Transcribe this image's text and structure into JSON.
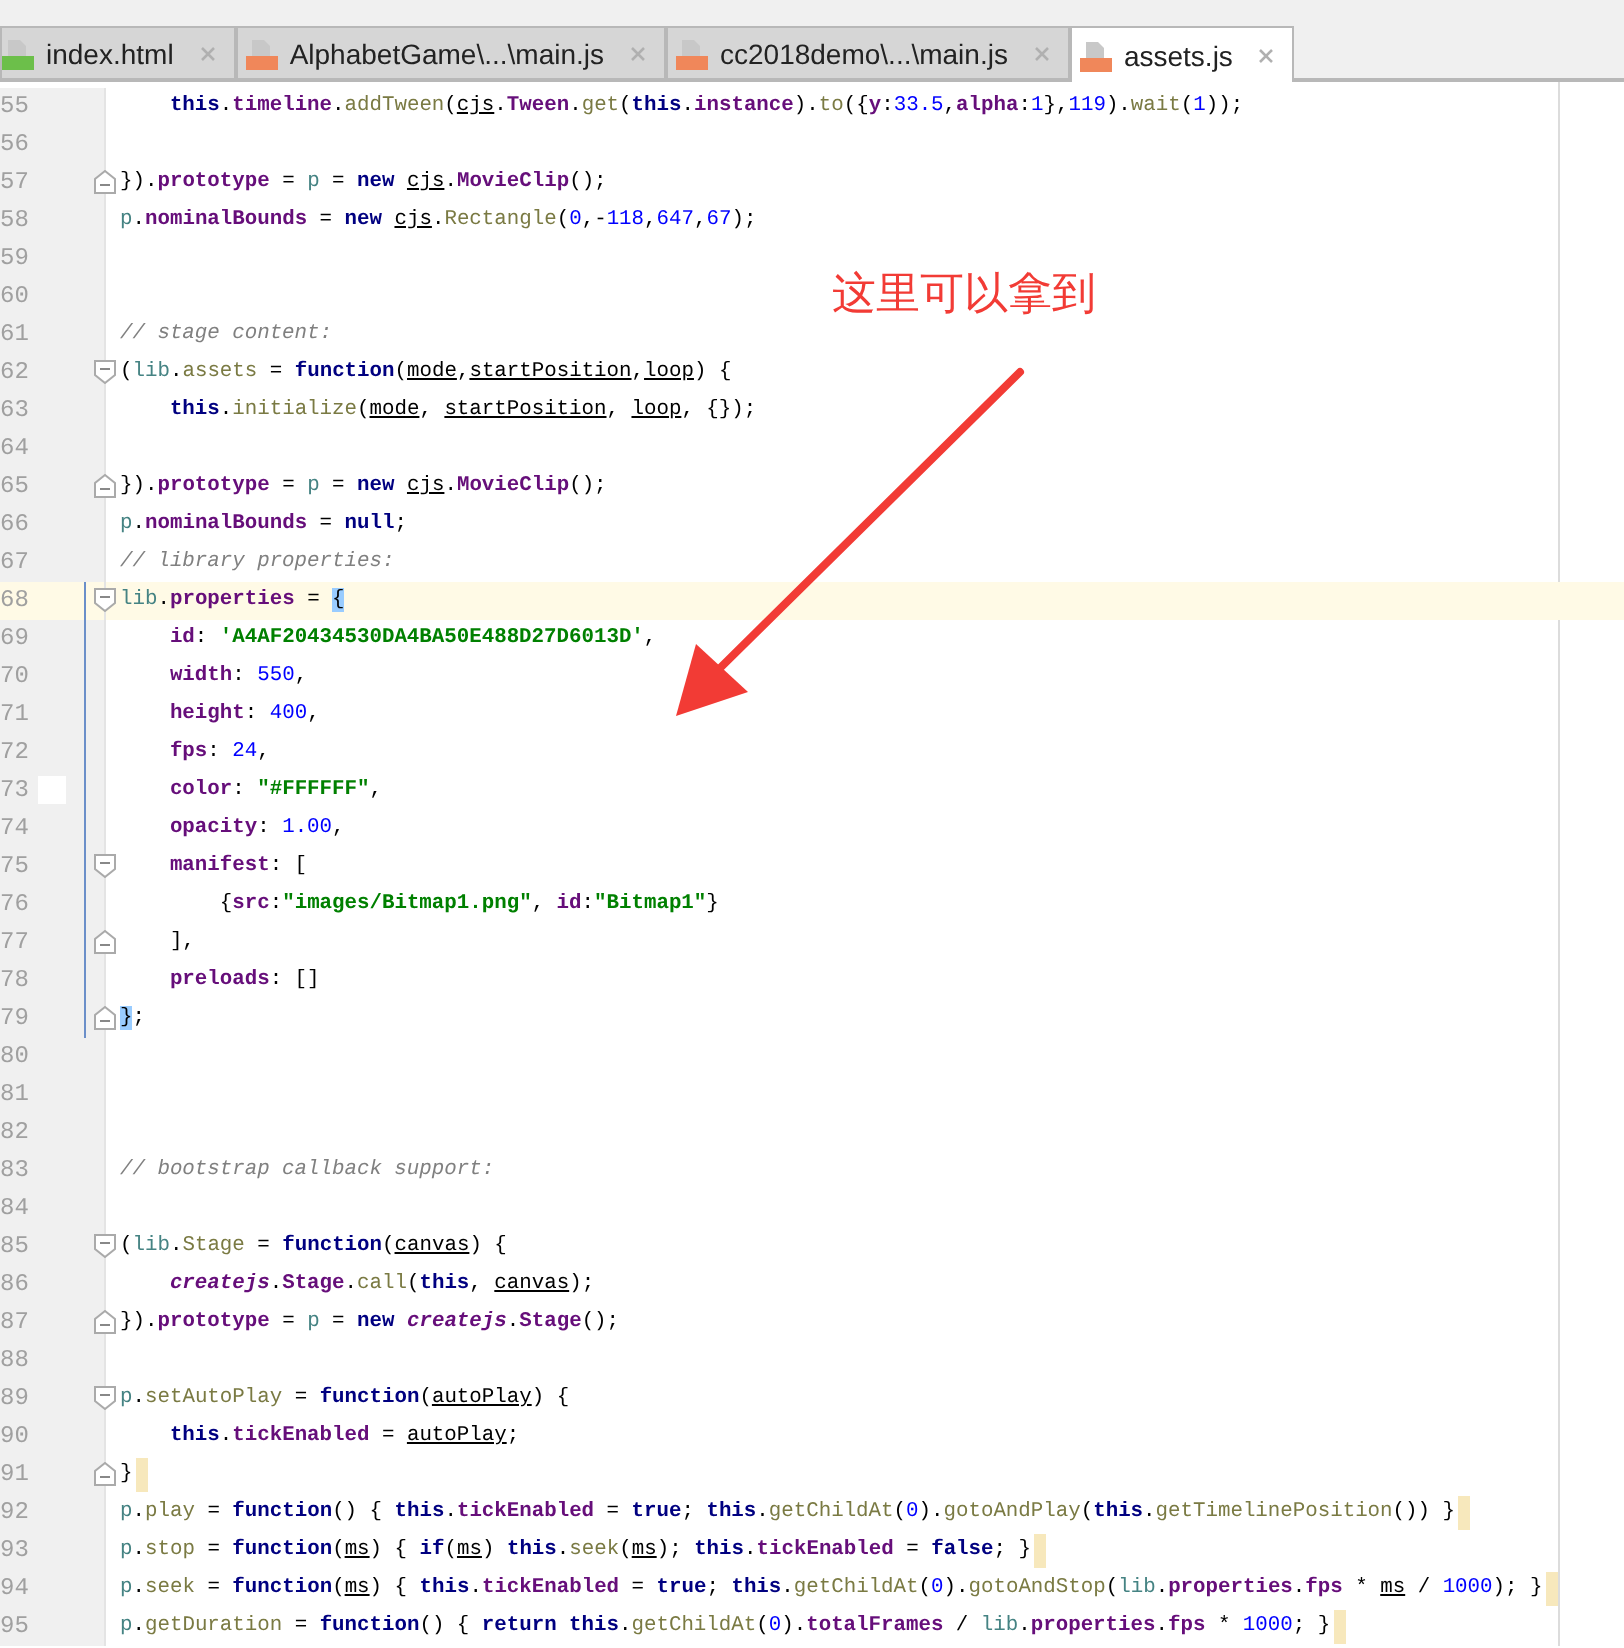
{
  "tabs": [
    {
      "label": "index.html",
      "kind": "html",
      "selected": false
    },
    {
      "label": "AlphabetGame\\...\\main.js",
      "kind": "js",
      "selected": false
    },
    {
      "label": "cc2018demo\\...\\main.js",
      "kind": "js",
      "selected": false
    },
    {
      "label": "assets.js",
      "kind": "js",
      "selected": true
    }
  ],
  "editor": {
    "lines": [
      {
        "number": "55",
        "indented": true,
        "tokens": [
          {
            "kind": "kw",
            "text": "this"
          },
          {
            "kind": "plain",
            "text": "."
          },
          {
            "kind": "prop",
            "text": "timeline"
          },
          {
            "kind": "plain",
            "text": "."
          },
          {
            "kind": "fn",
            "text": "addTween"
          },
          {
            "kind": "plain",
            "text": "("
          },
          {
            "kind": "param",
            "text": "cjs"
          },
          {
            "kind": "plain",
            "text": "."
          },
          {
            "kind": "prop",
            "text": "Tween"
          },
          {
            "kind": "plain",
            "text": "."
          },
          {
            "kind": "fn",
            "text": "get"
          },
          {
            "kind": "plain",
            "text": "("
          },
          {
            "kind": "kw",
            "text": "this"
          },
          {
            "kind": "plain",
            "text": "."
          },
          {
            "kind": "prop",
            "text": "instance"
          },
          {
            "kind": "plain",
            "text": ")."
          },
          {
            "kind": "fn",
            "text": "to"
          },
          {
            "kind": "plain",
            "text": "({"
          },
          {
            "kind": "prop",
            "text": "y"
          },
          {
            "kind": "plain",
            "text": ":"
          },
          {
            "kind": "num",
            "text": "33.5"
          },
          {
            "kind": "plain",
            "text": ","
          },
          {
            "kind": "prop",
            "text": "alpha"
          },
          {
            "kind": "plain",
            "text": ":"
          },
          {
            "kind": "num",
            "text": "1"
          },
          {
            "kind": "plain",
            "text": "},"
          },
          {
            "kind": "num",
            "text": "119"
          },
          {
            "kind": "plain",
            "text": ")."
          },
          {
            "kind": "fn",
            "text": "wait"
          },
          {
            "kind": "plain",
            "text": "("
          },
          {
            "kind": "num",
            "text": "1"
          },
          {
            "kind": "plain",
            "text": "));"
          }
        ]
      },
      {
        "number": "56"
      },
      {
        "number": "57",
        "fold_end": true,
        "tokens": [
          {
            "kind": "plain",
            "text": "})."
          },
          {
            "kind": "prop",
            "text": "prototype"
          },
          {
            "kind": "plain",
            "text": " = "
          },
          {
            "kind": "glob",
            "text": "p"
          },
          {
            "kind": "plain",
            "text": " = "
          },
          {
            "kind": "kw",
            "text": "new "
          },
          {
            "kind": "param",
            "text": "cjs"
          },
          {
            "kind": "plain",
            "text": "."
          },
          {
            "kind": "prop",
            "text": "MovieClip"
          },
          {
            "kind": "plain",
            "text": "();"
          }
        ]
      },
      {
        "number": "58",
        "tokens": [
          {
            "kind": "glob",
            "text": "p"
          },
          {
            "kind": "plain",
            "text": "."
          },
          {
            "kind": "prop",
            "text": "nominalBounds"
          },
          {
            "kind": "plain",
            "text": " = "
          },
          {
            "kind": "kw",
            "text": "new "
          },
          {
            "kind": "param",
            "text": "cjs"
          },
          {
            "kind": "plain",
            "text": "."
          },
          {
            "kind": "fn",
            "text": "Rectangle"
          },
          {
            "kind": "plain",
            "text": "("
          },
          {
            "kind": "num",
            "text": "0"
          },
          {
            "kind": "plain",
            "text": ",-"
          },
          {
            "kind": "num",
            "text": "118"
          },
          {
            "kind": "plain",
            "text": ","
          },
          {
            "kind": "num",
            "text": "647"
          },
          {
            "kind": "plain",
            "text": ","
          },
          {
            "kind": "num",
            "text": "67"
          },
          {
            "kind": "plain",
            "text": ");"
          }
        ]
      },
      {
        "number": "59"
      },
      {
        "number": "60"
      },
      {
        "number": "61",
        "tokens": [
          {
            "kind": "comment",
            "text": "// stage content:"
          }
        ]
      },
      {
        "number": "62",
        "fold_start": true,
        "tokens": [
          {
            "kind": "plain",
            "text": "("
          },
          {
            "kind": "glob",
            "text": "lib"
          },
          {
            "kind": "plain",
            "text": "."
          },
          {
            "kind": "fn",
            "text": "assets"
          },
          {
            "kind": "plain",
            "text": " = "
          },
          {
            "kind": "kw",
            "text": "function"
          },
          {
            "kind": "plain",
            "text": "("
          },
          {
            "kind": "param",
            "text": "mode"
          },
          {
            "kind": "plain",
            "text": ","
          },
          {
            "kind": "param",
            "text": "startPosition"
          },
          {
            "kind": "plain",
            "text": ","
          },
          {
            "kind": "param",
            "text": "loop"
          },
          {
            "kind": "plain",
            "text": ") {"
          }
        ]
      },
      {
        "number": "63",
        "indented": true,
        "tokens": [
          {
            "kind": "kw",
            "text": "this"
          },
          {
            "kind": "plain",
            "text": "."
          },
          {
            "kind": "fn",
            "text": "initialize"
          },
          {
            "kind": "plain",
            "text": "("
          },
          {
            "kind": "param",
            "text": "mode"
          },
          {
            "kind": "plain",
            "text": ", "
          },
          {
            "kind": "param",
            "text": "startPosition"
          },
          {
            "kind": "plain",
            "text": ", "
          },
          {
            "kind": "param",
            "text": "loop"
          },
          {
            "kind": "plain",
            "text": ", {});"
          }
        ]
      },
      {
        "number": "64"
      },
      {
        "number": "65",
        "fold_end": true,
        "tokens": [
          {
            "kind": "plain",
            "text": "})."
          },
          {
            "kind": "prop",
            "text": "prototype"
          },
          {
            "kind": "plain",
            "text": " = "
          },
          {
            "kind": "glob",
            "text": "p"
          },
          {
            "kind": "plain",
            "text": " = "
          },
          {
            "kind": "kw",
            "text": "new "
          },
          {
            "kind": "param",
            "text": "cjs"
          },
          {
            "kind": "plain",
            "text": "."
          },
          {
            "kind": "prop",
            "text": "MovieClip"
          },
          {
            "kind": "plain",
            "text": "();"
          }
        ]
      },
      {
        "number": "66",
        "tokens": [
          {
            "kind": "glob",
            "text": "p"
          },
          {
            "kind": "plain",
            "text": "."
          },
          {
            "kind": "prop",
            "text": "nominalBounds"
          },
          {
            "kind": "plain",
            "text": " = "
          },
          {
            "kind": "kw",
            "text": "null"
          },
          {
            "kind": "plain",
            "text": ";"
          }
        ]
      },
      {
        "number": "67",
        "tokens": [
          {
            "kind": "comment",
            "text": "// library properties:"
          }
        ]
      },
      {
        "number": "68",
        "fold_start": true,
        "current": true,
        "in_block": true,
        "tokens": [
          {
            "kind": "glob",
            "text": "lib"
          },
          {
            "kind": "plain",
            "text": "."
          },
          {
            "kind": "prop",
            "text": "properties"
          },
          {
            "kind": "plain",
            "text": " = "
          },
          {
            "kind": "match",
            "text": "{"
          }
        ]
      },
      {
        "number": "69",
        "indented": true,
        "in_block": true,
        "tokens": [
          {
            "kind": "prop",
            "text": "id"
          },
          {
            "kind": "plain",
            "text": ": "
          },
          {
            "kind": "str",
            "text": "'A4AF20434530DA4BA50E488D27D6013D'"
          },
          {
            "kind": "plain",
            "text": ","
          }
        ]
      },
      {
        "number": "70",
        "indented": true,
        "in_block": true,
        "tokens": [
          {
            "kind": "prop",
            "text": "width"
          },
          {
            "kind": "plain",
            "text": ": "
          },
          {
            "kind": "num",
            "text": "550"
          },
          {
            "kind": "plain",
            "text": ","
          }
        ]
      },
      {
        "number": "71",
        "indented": true,
        "in_block": true,
        "tokens": [
          {
            "kind": "prop",
            "text": "height"
          },
          {
            "kind": "plain",
            "text": ": "
          },
          {
            "kind": "num",
            "text": "400"
          },
          {
            "kind": "plain",
            "text": ","
          }
        ]
      },
      {
        "number": "72",
        "indented": true,
        "in_block": true,
        "tokens": [
          {
            "kind": "prop",
            "text": "fps"
          },
          {
            "kind": "plain",
            "text": ": "
          },
          {
            "kind": "num",
            "text": "24"
          },
          {
            "kind": "plain",
            "text": ","
          }
        ]
      },
      {
        "number": "73",
        "indented": true,
        "in_block": true,
        "swatch": true,
        "tokens": [
          {
            "kind": "prop",
            "text": "color"
          },
          {
            "kind": "plain",
            "text": ": "
          },
          {
            "kind": "str",
            "text": "\"#FFFFFF\""
          },
          {
            "kind": "plain",
            "text": ","
          }
        ]
      },
      {
        "number": "74",
        "indented": true,
        "in_block": true,
        "tokens": [
          {
            "kind": "prop",
            "text": "opacity"
          },
          {
            "kind": "plain",
            "text": ": "
          },
          {
            "kind": "num",
            "text": "1.00"
          },
          {
            "kind": "plain",
            "text": ","
          }
        ]
      },
      {
        "number": "75",
        "indented": true,
        "fold_start": true,
        "in_block": true,
        "tokens": [
          {
            "kind": "prop",
            "text": "manifest"
          },
          {
            "kind": "plain",
            "text": ": ["
          }
        ]
      },
      {
        "number": "76",
        "indented": true,
        "in_block": true,
        "tokens": [
          {
            "kind": "plain",
            "text": "    {"
          },
          {
            "kind": "prop",
            "text": "src"
          },
          {
            "kind": "plain",
            "text": ":"
          },
          {
            "kind": "str",
            "text": "\"images/Bitmap1.png\""
          },
          {
            "kind": "plain",
            "text": ", "
          },
          {
            "kind": "prop",
            "text": "id"
          },
          {
            "kind": "plain",
            "text": ":"
          },
          {
            "kind": "str",
            "text": "\"Bitmap1\""
          },
          {
            "kind": "plain",
            "text": "}"
          }
        ]
      },
      {
        "number": "77",
        "indented": true,
        "fold_end": true,
        "in_block": true,
        "tokens": [
          {
            "kind": "plain",
            "text": "],"
          }
        ]
      },
      {
        "number": "78",
        "indented": true,
        "in_block": true,
        "tokens": [
          {
            "kind": "prop",
            "text": "preloads"
          },
          {
            "kind": "plain",
            "text": ": []"
          }
        ]
      },
      {
        "number": "79",
        "fold_end": true,
        "in_block": true,
        "tokens": [
          {
            "kind": "match",
            "text": "}"
          },
          {
            "kind": "plain",
            "text": ";"
          }
        ]
      },
      {
        "number": "80"
      },
      {
        "number": "81"
      },
      {
        "number": "82"
      },
      {
        "number": "83",
        "tokens": [
          {
            "kind": "comment",
            "text": "// bootstrap callback support:"
          }
        ]
      },
      {
        "number": "84"
      },
      {
        "number": "85",
        "fold_start": true,
        "tokens": [
          {
            "kind": "plain",
            "text": "("
          },
          {
            "kind": "glob",
            "text": "lib"
          },
          {
            "kind": "plain",
            "text": "."
          },
          {
            "kind": "fn",
            "text": "Stage"
          },
          {
            "kind": "plain",
            "text": " = "
          },
          {
            "kind": "kw",
            "text": "function"
          },
          {
            "kind": "plain",
            "text": "("
          },
          {
            "kind": "param",
            "text": "canvas"
          },
          {
            "kind": "plain",
            "text": ") {"
          }
        ]
      },
      {
        "number": "86",
        "indented": true,
        "tokens": [
          {
            "kind": "italic",
            "text": "createjs"
          },
          {
            "kind": "plain",
            "text": "."
          },
          {
            "kind": "prop",
            "text": "Stage"
          },
          {
            "kind": "plain",
            "text": "."
          },
          {
            "kind": "fn",
            "text": "call"
          },
          {
            "kind": "plain",
            "text": "("
          },
          {
            "kind": "kw",
            "text": "this"
          },
          {
            "kind": "plain",
            "text": ", "
          },
          {
            "kind": "param",
            "text": "canvas"
          },
          {
            "kind": "plain",
            "text": ");"
          }
        ]
      },
      {
        "number": "87",
        "fold_end": true,
        "tokens": [
          {
            "kind": "plain",
            "text": "})."
          },
          {
            "kind": "prop",
            "text": "prototype"
          },
          {
            "kind": "plain",
            "text": " = "
          },
          {
            "kind": "glob",
            "text": "p"
          },
          {
            "kind": "plain",
            "text": " = "
          },
          {
            "kind": "kw",
            "text": "new "
          },
          {
            "kind": "italic",
            "text": "createjs"
          },
          {
            "kind": "plain",
            "text": "."
          },
          {
            "kind": "prop",
            "text": "Stage"
          },
          {
            "kind": "plain",
            "text": "();"
          }
        ]
      },
      {
        "number": "88"
      },
      {
        "number": "89",
        "fold_start": true,
        "tokens": [
          {
            "kind": "glob",
            "text": "p"
          },
          {
            "kind": "plain",
            "text": "."
          },
          {
            "kind": "fn",
            "text": "setAutoPlay"
          },
          {
            "kind": "plain",
            "text": " = "
          },
          {
            "kind": "kw",
            "text": "function"
          },
          {
            "kind": "plain",
            "text": "("
          },
          {
            "kind": "param",
            "text": "autoPlay"
          },
          {
            "kind": "plain",
            "text": ") {"
          }
        ]
      },
      {
        "number": "90",
        "indented": true,
        "tokens": [
          {
            "kind": "kw",
            "text": "this"
          },
          {
            "kind": "plain",
            "text": "."
          },
          {
            "kind": "prop",
            "text": "tickEnabled"
          },
          {
            "kind": "plain",
            "text": " = "
          },
          {
            "kind": "param",
            "text": "autoPlay"
          },
          {
            "kind": "plain",
            "text": ";"
          }
        ]
      },
      {
        "number": "91",
        "fold_end": true,
        "end_mark": true,
        "tokens": [
          {
            "kind": "plain",
            "text": "}"
          }
        ]
      },
      {
        "number": "92",
        "end_mark": true,
        "tokens": [
          {
            "kind": "glob",
            "text": "p"
          },
          {
            "kind": "plain",
            "text": "."
          },
          {
            "kind": "fn",
            "text": "play"
          },
          {
            "kind": "plain",
            "text": " = "
          },
          {
            "kind": "kw",
            "text": "function"
          },
          {
            "kind": "plain",
            "text": "() { "
          },
          {
            "kind": "kw",
            "text": "this"
          },
          {
            "kind": "plain",
            "text": "."
          },
          {
            "kind": "prop",
            "text": "tickEnabled"
          },
          {
            "kind": "plain",
            "text": " = "
          },
          {
            "kind": "kw",
            "text": "true"
          },
          {
            "kind": "plain",
            "text": "; "
          },
          {
            "kind": "kw",
            "text": "this"
          },
          {
            "kind": "plain",
            "text": "."
          },
          {
            "kind": "fn",
            "text": "getChildAt"
          },
          {
            "kind": "plain",
            "text": "("
          },
          {
            "kind": "num",
            "text": "0"
          },
          {
            "kind": "plain",
            "text": ")."
          },
          {
            "kind": "fn",
            "text": "gotoAndPlay"
          },
          {
            "kind": "plain",
            "text": "("
          },
          {
            "kind": "kw",
            "text": "this"
          },
          {
            "kind": "plain",
            "text": "."
          },
          {
            "kind": "fn",
            "text": "getTimelinePosition"
          },
          {
            "kind": "plain",
            "text": "()) }"
          }
        ]
      },
      {
        "number": "93",
        "end_mark": true,
        "tokens": [
          {
            "kind": "glob",
            "text": "p"
          },
          {
            "kind": "plain",
            "text": "."
          },
          {
            "kind": "fn",
            "text": "stop"
          },
          {
            "kind": "plain",
            "text": " = "
          },
          {
            "kind": "kw",
            "text": "function"
          },
          {
            "kind": "plain",
            "text": "("
          },
          {
            "kind": "param",
            "text": "ms"
          },
          {
            "kind": "plain",
            "text": ") { "
          },
          {
            "kind": "kw",
            "text": "if"
          },
          {
            "kind": "plain",
            "text": "("
          },
          {
            "kind": "param",
            "text": "ms"
          },
          {
            "kind": "plain",
            "text": ") "
          },
          {
            "kind": "kw",
            "text": "this"
          },
          {
            "kind": "plain",
            "text": "."
          },
          {
            "kind": "fn",
            "text": "seek"
          },
          {
            "kind": "plain",
            "text": "("
          },
          {
            "kind": "param",
            "text": "ms"
          },
          {
            "kind": "plain",
            "text": "); "
          },
          {
            "kind": "kw",
            "text": "this"
          },
          {
            "kind": "plain",
            "text": "."
          },
          {
            "kind": "prop",
            "text": "tickEnabled"
          },
          {
            "kind": "plain",
            "text": " = "
          },
          {
            "kind": "kw",
            "text": "false"
          },
          {
            "kind": "plain",
            "text": "; }"
          }
        ]
      },
      {
        "number": "94",
        "end_mark": true,
        "tokens": [
          {
            "kind": "glob",
            "text": "p"
          },
          {
            "kind": "plain",
            "text": "."
          },
          {
            "kind": "fn",
            "text": "seek"
          },
          {
            "kind": "plain",
            "text": " = "
          },
          {
            "kind": "kw",
            "text": "function"
          },
          {
            "kind": "plain",
            "text": "("
          },
          {
            "kind": "param",
            "text": "ms"
          },
          {
            "kind": "plain",
            "text": ") { "
          },
          {
            "kind": "kw",
            "text": "this"
          },
          {
            "kind": "plain",
            "text": "."
          },
          {
            "kind": "prop",
            "text": "tickEnabled"
          },
          {
            "kind": "plain",
            "text": " = "
          },
          {
            "kind": "kw",
            "text": "true"
          },
          {
            "kind": "plain",
            "text": "; "
          },
          {
            "kind": "kw",
            "text": "this"
          },
          {
            "kind": "plain",
            "text": "."
          },
          {
            "kind": "fn",
            "text": "getChildAt"
          },
          {
            "kind": "plain",
            "text": "("
          },
          {
            "kind": "num",
            "text": "0"
          },
          {
            "kind": "plain",
            "text": ")."
          },
          {
            "kind": "fn",
            "text": "gotoAndStop"
          },
          {
            "kind": "plain",
            "text": "("
          },
          {
            "kind": "glob",
            "text": "lib"
          },
          {
            "kind": "plain",
            "text": "."
          },
          {
            "kind": "prop",
            "text": "properties"
          },
          {
            "kind": "plain",
            "text": "."
          },
          {
            "kind": "prop",
            "text": "fps"
          },
          {
            "kind": "plain",
            "text": " * "
          },
          {
            "kind": "param",
            "text": "ms"
          },
          {
            "kind": "plain",
            "text": " / "
          },
          {
            "kind": "num",
            "text": "1000"
          },
          {
            "kind": "plain",
            "text": "); }"
          }
        ]
      },
      {
        "number": "95",
        "end_mark": true,
        "tokens": [
          {
            "kind": "glob",
            "text": "p"
          },
          {
            "kind": "plain",
            "text": "."
          },
          {
            "kind": "fn",
            "text": "getDuration"
          },
          {
            "kind": "plain",
            "text": " = "
          },
          {
            "kind": "kw",
            "text": "function"
          },
          {
            "kind": "plain",
            "text": "() { "
          },
          {
            "kind": "kw",
            "text": "return "
          },
          {
            "kind": "kw",
            "text": "this"
          },
          {
            "kind": "plain",
            "text": "."
          },
          {
            "kind": "fn",
            "text": "getChildAt"
          },
          {
            "kind": "plain",
            "text": "("
          },
          {
            "kind": "num",
            "text": "0"
          },
          {
            "kind": "plain",
            "text": ")."
          },
          {
            "kind": "prop",
            "text": "totalFrames"
          },
          {
            "kind": "plain",
            "text": " / "
          },
          {
            "kind": "glob",
            "text": "lib"
          },
          {
            "kind": "plain",
            "text": "."
          },
          {
            "kind": "prop",
            "text": "properties"
          },
          {
            "kind": "plain",
            "text": "."
          },
          {
            "kind": "prop",
            "text": "fps"
          },
          {
            "kind": "plain",
            "text": " * "
          },
          {
            "kind": "num",
            "text": "1000"
          },
          {
            "kind": "plain",
            "text": "; }"
          }
        ]
      }
    ]
  },
  "annotation": {
    "text": "这里可以拿到"
  }
}
